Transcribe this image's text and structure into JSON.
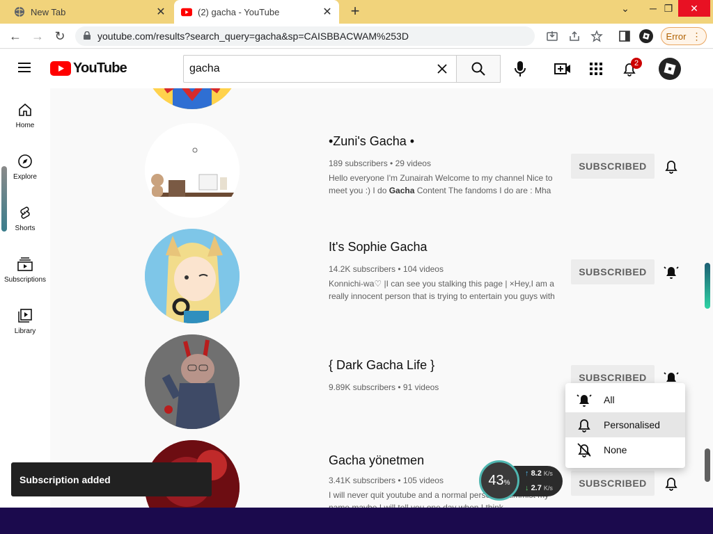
{
  "browser": {
    "tabs": [
      {
        "title": "New Tab",
        "icon": "globe-icon"
      },
      {
        "title": "(2) gacha - YouTube",
        "icon": "youtube-icon"
      }
    ],
    "url": "youtube.com/results?search_query=gacha&sp=CAISBBACWAM%253D",
    "error_label": "Error"
  },
  "youtube": {
    "logo_text": "YouTube",
    "search_value": "gacha",
    "notification_count": "2",
    "sidebar": [
      {
        "label": "Home",
        "icon": "home-icon"
      },
      {
        "label": "Explore",
        "icon": "compass-icon"
      },
      {
        "label": "Shorts",
        "icon": "shorts-icon"
      },
      {
        "label": "Subscriptions",
        "icon": "subscriptions-icon"
      },
      {
        "label": "Library",
        "icon": "library-icon"
      }
    ],
    "channels": [
      {
        "name": "•Zuni's Gacha •",
        "meta": "189 subscribers • 29 videos",
        "desc_pre": "Hello everyone I'm Zunairah Welcome to my channel Nice to meet you :) I do ",
        "desc_bold": "Gacha",
        "desc_post": " Content The fandoms I do are : Mha",
        "button": "SUBSCRIBED",
        "bell": "bell-outline-icon"
      },
      {
        "name": "It's Sophie Gacha",
        "meta": "14.2K subscribers • 104 videos",
        "desc_pre": "Konnichi-wa♡ |I can see you stalking this page | ×Hey,I am a really innocent person that is trying to entertain you guys with",
        "desc_bold": "",
        "desc_post": "",
        "button": "SUBSCRIBED",
        "bell": "bell-ringing-icon"
      },
      {
        "name": "{ Dark Gacha Life }",
        "meta": "9.89K subscribers • 91 videos",
        "desc_pre": "",
        "desc_bold": "",
        "desc_post": "",
        "button": "SUBSCRIBED",
        "bell": "bell-ringing-icon"
      },
      {
        "name": "Gacha yönetmen",
        "meta": "3.41K subscribers • 105 videos",
        "desc_pre": "I will never quit youtube and a normal person ... almmist my name maybe I will tell you one day when I think",
        "desc_bold": "",
        "desc_post": "",
        "button": "SUBSCRIBED",
        "bell": "bell-outline-icon"
      }
    ],
    "notification_menu": [
      {
        "label": "All",
        "icon": "bell-ringing-icon"
      },
      {
        "label": "Personalised",
        "icon": "bell-outline-icon"
      },
      {
        "label": "None",
        "icon": "bell-off-icon"
      }
    ],
    "toast": "Subscription added"
  },
  "speed_widget": {
    "percent": "43",
    "percent_unit": "%",
    "up": "8.2",
    "down": "2.7",
    "unit": "K/s"
  }
}
